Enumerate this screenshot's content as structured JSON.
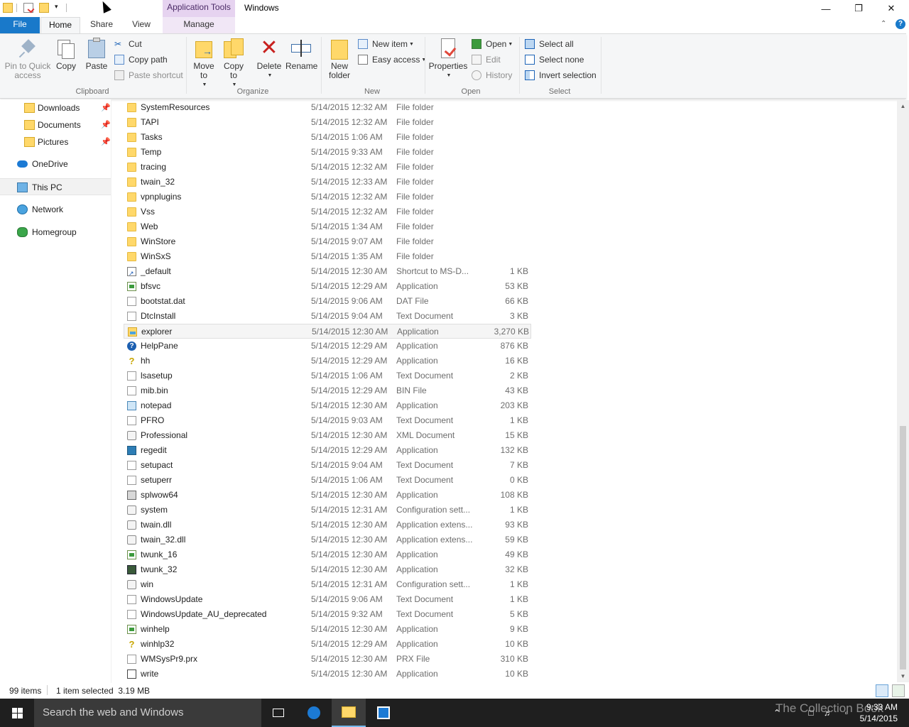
{
  "window": {
    "title": "Windows",
    "context_tab": "Application Tools",
    "minimize": "—",
    "maximize": "❐",
    "close": "✕"
  },
  "tabs": {
    "file": "File",
    "home": "Home",
    "share": "Share",
    "view": "View",
    "manage": "Manage"
  },
  "ribbon": {
    "clipboard": {
      "label": "Clipboard",
      "pin": "Pin to Quick access",
      "copy": "Copy",
      "paste": "Paste",
      "cut": "Cut",
      "copy_path": "Copy path",
      "paste_shortcut": "Paste shortcut"
    },
    "organize": {
      "label": "Organize",
      "move_to": "Move to",
      "copy_to": "Copy to",
      "delete": "Delete",
      "rename": "Rename"
    },
    "new": {
      "label": "New",
      "new_folder": "New folder",
      "new_item": "New item",
      "easy_access": "Easy access"
    },
    "open": {
      "label": "Open",
      "properties": "Properties",
      "open": "Open",
      "edit": "Edit",
      "history": "History"
    },
    "select": {
      "label": "Select",
      "select_all": "Select all",
      "select_none": "Select none",
      "invert": "Invert selection"
    }
  },
  "nav": {
    "downloads": "Downloads",
    "documents": "Documents",
    "pictures": "Pictures",
    "onedrive": "OneDrive",
    "thispc": "This PC",
    "network": "Network",
    "homegroup": "Homegroup"
  },
  "files": [
    {
      "name": "SystemResources",
      "date": "5/14/2015 12:32 AM",
      "type": "File folder",
      "size": "",
      "icon": "folder"
    },
    {
      "name": "TAPI",
      "date": "5/14/2015 12:32 AM",
      "type": "File folder",
      "size": "",
      "icon": "folder"
    },
    {
      "name": "Tasks",
      "date": "5/14/2015 1:06 AM",
      "type": "File folder",
      "size": "",
      "icon": "folder"
    },
    {
      "name": "Temp",
      "date": "5/14/2015 9:33 AM",
      "type": "File folder",
      "size": "",
      "icon": "folder"
    },
    {
      "name": "tracing",
      "date": "5/14/2015 12:32 AM",
      "type": "File folder",
      "size": "",
      "icon": "folder"
    },
    {
      "name": "twain_32",
      "date": "5/14/2015 12:33 AM",
      "type": "File folder",
      "size": "",
      "icon": "folder"
    },
    {
      "name": "vpnplugins",
      "date": "5/14/2015 12:32 AM",
      "type": "File folder",
      "size": "",
      "icon": "folder"
    },
    {
      "name": "Vss",
      "date": "5/14/2015 12:32 AM",
      "type": "File folder",
      "size": "",
      "icon": "folder"
    },
    {
      "name": "Web",
      "date": "5/14/2015 1:34 AM",
      "type": "File folder",
      "size": "",
      "icon": "folder"
    },
    {
      "name": "WinStore",
      "date": "5/14/2015 9:07 AM",
      "type": "File folder",
      "size": "",
      "icon": "folder"
    },
    {
      "name": "WinSxS",
      "date": "5/14/2015 1:35 AM",
      "type": "File folder",
      "size": "",
      "icon": "folder"
    },
    {
      "name": "_default",
      "date": "5/14/2015 12:30 AM",
      "type": "Shortcut to MS-D...",
      "size": "1 KB",
      "icon": "shortcut"
    },
    {
      "name": "bfsvc",
      "date": "5/14/2015 12:29 AM",
      "type": "Application",
      "size": "53 KB",
      "icon": "app"
    },
    {
      "name": "bootstat.dat",
      "date": "5/14/2015 9:06 AM",
      "type": "DAT File",
      "size": "66 KB",
      "icon": "doc"
    },
    {
      "name": "DtcInstall",
      "date": "5/14/2015 9:04 AM",
      "type": "Text Document",
      "size": "3 KB",
      "icon": "doc"
    },
    {
      "name": "explorer",
      "date": "5/14/2015 12:30 AM",
      "type": "Application",
      "size": "3,270 KB",
      "icon": "explorer",
      "selected": true
    },
    {
      "name": "HelpPane",
      "date": "5/14/2015 12:29 AM",
      "type": "Application",
      "size": "876 KB",
      "icon": "help"
    },
    {
      "name": "hh",
      "date": "5/14/2015 12:29 AM",
      "type": "Application",
      "size": "16 KB",
      "icon": "yhelp"
    },
    {
      "name": "lsasetup",
      "date": "5/14/2015 1:06 AM",
      "type": "Text Document",
      "size": "2 KB",
      "icon": "doc"
    },
    {
      "name": "mib.bin",
      "date": "5/14/2015 12:29 AM",
      "type": "BIN File",
      "size": "43 KB",
      "icon": "doc"
    },
    {
      "name": "notepad",
      "date": "5/14/2015 12:30 AM",
      "type": "Application",
      "size": "203 KB",
      "icon": "note"
    },
    {
      "name": "PFRO",
      "date": "5/14/2015 9:03 AM",
      "type": "Text Document",
      "size": "1 KB",
      "icon": "doc"
    },
    {
      "name": "Professional",
      "date": "5/14/2015 12:30 AM",
      "type": "XML Document",
      "size": "15 KB",
      "icon": "gear"
    },
    {
      "name": "regedit",
      "date": "5/14/2015 12:29 AM",
      "type": "Application",
      "size": "132 KB",
      "icon": "reg"
    },
    {
      "name": "setupact",
      "date": "5/14/2015 9:04 AM",
      "type": "Text Document",
      "size": "7 KB",
      "icon": "doc"
    },
    {
      "name": "setuperr",
      "date": "5/14/2015 1:06 AM",
      "type": "Text Document",
      "size": "0 KB",
      "icon": "doc"
    },
    {
      "name": "splwow64",
      "date": "5/14/2015 12:30 AM",
      "type": "Application",
      "size": "108 KB",
      "icon": "printer"
    },
    {
      "name": "system",
      "date": "5/14/2015 12:31 AM",
      "type": "Configuration sett...",
      "size": "1 KB",
      "icon": "gear"
    },
    {
      "name": "twain.dll",
      "date": "5/14/2015 12:30 AM",
      "type": "Application extens...",
      "size": "93 KB",
      "icon": "gear"
    },
    {
      "name": "twain_32.dll",
      "date": "5/14/2015 12:30 AM",
      "type": "Application extens...",
      "size": "59 KB",
      "icon": "gear"
    },
    {
      "name": "twunk_16",
      "date": "5/14/2015 12:30 AM",
      "type": "Application",
      "size": "49 KB",
      "icon": "app"
    },
    {
      "name": "twunk_32",
      "date": "5/14/2015 12:30 AM",
      "type": "Application",
      "size": "32 KB",
      "icon": "dark"
    },
    {
      "name": "win",
      "date": "5/14/2015 12:31 AM",
      "type": "Configuration sett...",
      "size": "1 KB",
      "icon": "gear"
    },
    {
      "name": "WindowsUpdate",
      "date": "5/14/2015 9:06 AM",
      "type": "Text Document",
      "size": "1 KB",
      "icon": "doc"
    },
    {
      "name": "WindowsUpdate_AU_deprecated",
      "date": "5/14/2015 9:32 AM",
      "type": "Text Document",
      "size": "5 KB",
      "icon": "doc"
    },
    {
      "name": "winhelp",
      "date": "5/14/2015 12:30 AM",
      "type": "Application",
      "size": "9 KB",
      "icon": "app"
    },
    {
      "name": "winhlp32",
      "date": "5/14/2015 12:29 AM",
      "type": "Application",
      "size": "10 KB",
      "icon": "yhelp"
    },
    {
      "name": "WMSysPr9.prx",
      "date": "5/14/2015 12:30 AM",
      "type": "PRX File",
      "size": "310 KB",
      "icon": "doc"
    },
    {
      "name": "write",
      "date": "5/14/2015 12:30 AM",
      "type": "Application",
      "size": "10 KB",
      "icon": "write"
    }
  ],
  "status": {
    "items": "99 items",
    "selected": "1 item selected  3.19 MB"
  },
  "taskbar": {
    "search_placeholder": "Search the web and Windows",
    "time": "9:33 AM",
    "date": "5/14/2015",
    "watermark": "The Collection Book"
  },
  "colors": {
    "accent": "#1979ca",
    "context_tab": "#e6d3f0",
    "taskbar": "#1f1f1f"
  }
}
